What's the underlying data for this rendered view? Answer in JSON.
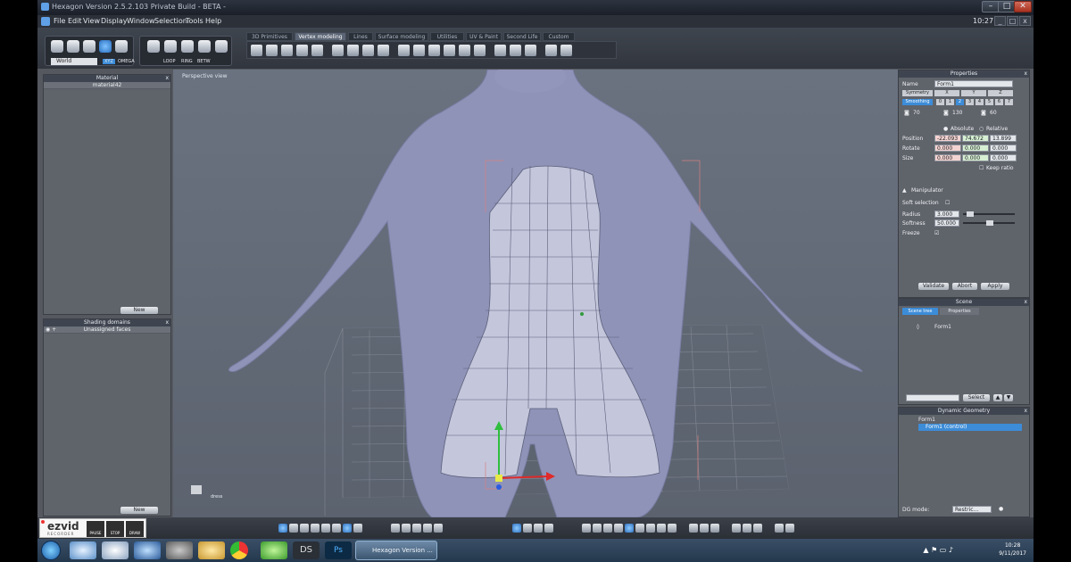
{
  "window": {
    "title": "Hexagon Version 2.5.2.103 Private Build - BETA -",
    "clock": "10:27"
  },
  "menu": [
    "File",
    "Edit",
    "View",
    "Display",
    "Window",
    "Selection",
    "Tools",
    "Help"
  ],
  "toolbar": {
    "world_label": "World",
    "xyz_label": "XYZ",
    "omega_label": "OMEGA",
    "loop_label": "LOOP",
    "ring_label": "RING",
    "betw_label": "BETW"
  },
  "tabs": [
    {
      "label": "3D Primitives",
      "active": false
    },
    {
      "label": "Vertex modeling",
      "active": true
    },
    {
      "label": "Lines",
      "active": false
    },
    {
      "label": "Surface modeling",
      "active": false
    },
    {
      "label": "Utilities",
      "active": false
    },
    {
      "label": "UV & Paint",
      "active": false
    },
    {
      "label": "Second Life",
      "active": false
    },
    {
      "label": "Custom",
      "active": false
    }
  ],
  "material_panel": {
    "header": "Material",
    "item": "material42",
    "new_label": "New"
  },
  "shading_panel": {
    "header": "Shading domains",
    "item": "Unassigned faces",
    "new_label": "New"
  },
  "viewport": {
    "label": "Perspective view",
    "object_tag": "dress"
  },
  "properties": {
    "header": "Properties",
    "name_label": "Name",
    "name_value": "Form1",
    "symmetry_label": "Symmetry",
    "sym_axes": [
      "X",
      "Y",
      "Z"
    ],
    "smoothing_label": "Smoothing",
    "smoothing_levels": [
      "0",
      "1",
      "2",
      "3",
      "4",
      "5",
      "6",
      "7"
    ],
    "smoothing_active": "2",
    "angles": [
      "70",
      "130",
      "60"
    ],
    "absolute_label": "Absolute",
    "relative_label": "Relative",
    "position_label": "Position",
    "position": [
      "-22.093",
      "74.672",
      "13.899"
    ],
    "rotate_label": "Rotate",
    "rotate": [
      "0.000",
      "0.000",
      "0.000"
    ],
    "size_label": "Size",
    "size": [
      "0.000",
      "0.000",
      "0.000"
    ],
    "keep_ratio_label": "Keep ratio",
    "manipulator_label": "Manipulator",
    "soft_selection_label": "Soft selection",
    "radius_label": "Radius",
    "radius_value": "3.000",
    "softness_label": "Softness",
    "softness_value": "50.000",
    "freeze_label": "Freeze",
    "validate_label": "Validate",
    "abort_label": "Abort",
    "apply_label": "Apply"
  },
  "scene": {
    "header": "Scene",
    "tab_tree": "Scene tree",
    "tab_properties": "Properties",
    "item": "Form1",
    "select_label": "Select"
  },
  "dynamic_geometry": {
    "header": "Dynamic Geometry",
    "items": [
      "Form1",
      "Form1 (control)"
    ],
    "dg_mode_label": "DG mode:",
    "dg_mode_value": "Restric..."
  },
  "ezvid": {
    "logo": "ezvid",
    "sub": "RECORDER",
    "pause": "PAUSE",
    "stop": "STOP",
    "draw": "DRAW"
  },
  "taskbar": {
    "active_app": "Hexagon Version ...",
    "ds_label": "DS",
    "ps_label": "Ps",
    "time": "10:28",
    "date": "9/11/2017"
  },
  "colors": {
    "accent": "#3c8cd8",
    "viewport_bg": "#646b78",
    "body_mesh": "#8f93b8",
    "dress_mesh": "#c4c6dc"
  }
}
